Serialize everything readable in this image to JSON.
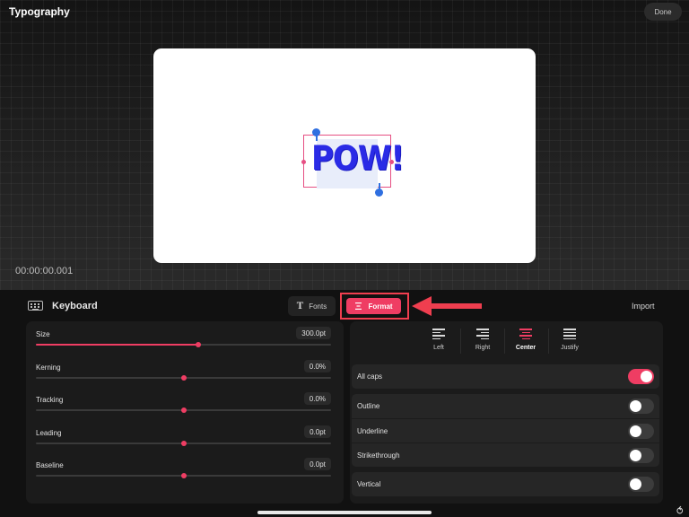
{
  "header": {
    "title": "Typography",
    "done_label": "Done"
  },
  "canvas": {
    "text": "POW!",
    "timecode": "00:00:00.001"
  },
  "toolbar": {
    "keyboard_label": "Keyboard",
    "fonts_label": "Fonts",
    "format_label": "Format",
    "import_label": "Import"
  },
  "sliders": [
    {
      "label": "Size",
      "value": "300.0pt",
      "level": 0.55
    },
    {
      "label": "Kerning",
      "value": "0.0%",
      "level": 0.5
    },
    {
      "label": "Tracking",
      "value": "0.0%",
      "level": 0.5
    },
    {
      "label": "Leading",
      "value": "0.0pt",
      "level": 0.5
    },
    {
      "label": "Baseline",
      "value": "0.0pt",
      "level": 0.5
    }
  ],
  "alignment": {
    "options": [
      {
        "label": "Left",
        "icon": "align-left-icon"
      },
      {
        "label": "Right",
        "icon": "align-right-icon"
      },
      {
        "label": "Center",
        "icon": "align-center-icon",
        "active": true
      },
      {
        "label": "Justify",
        "icon": "align-justify-icon"
      }
    ]
  },
  "toggles": {
    "all_caps": {
      "label": "All caps",
      "on": true
    },
    "outline": {
      "label": "Outline",
      "on": false
    },
    "underline": {
      "label": "Underline",
      "on": false
    },
    "strikethrough": {
      "label": "Strikethrough",
      "on": false
    },
    "vertical": {
      "label": "Vertical",
      "on": false
    }
  },
  "colors": {
    "accent": "#ef3d63",
    "text_color": "#2a2be6",
    "highlight": "#ef3e4f"
  }
}
